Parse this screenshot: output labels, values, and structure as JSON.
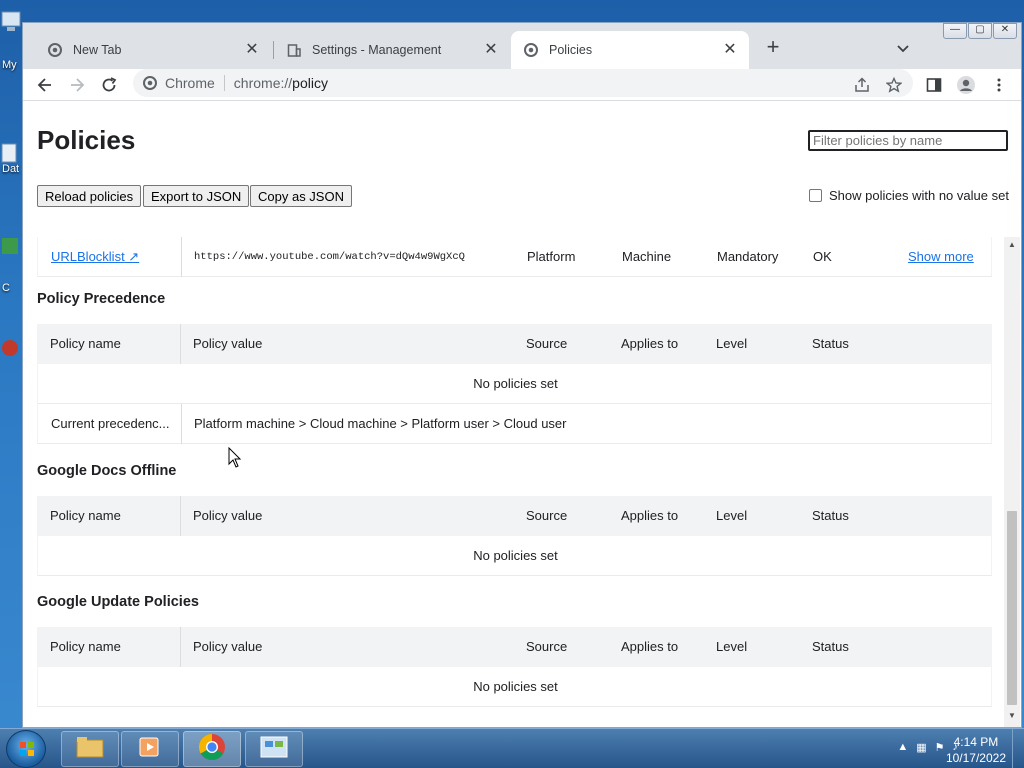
{
  "desktop": {
    "labels": [
      "My",
      "Dat",
      "C"
    ]
  },
  "browser": {
    "tabs": [
      {
        "title": "New Tab",
        "icon": "chrome-icon",
        "active": false
      },
      {
        "title": "Settings - Management",
        "icon": "building-icon",
        "active": false
      },
      {
        "title": "Policies",
        "icon": "chrome-icon",
        "active": true
      }
    ],
    "omnibox": {
      "chip": "Chrome",
      "url_scheme": "chrome://",
      "url_path": "policy"
    }
  },
  "page": {
    "title": "Policies",
    "filter_placeholder": "Filter policies by name",
    "buttons": {
      "reload": "Reload policies",
      "export": "Export to JSON",
      "copy": "Copy as JSON"
    },
    "show_no_value_label": "Show policies with no value set",
    "partial_row": {
      "name": "URLBlocklist",
      "value": "https://www.youtube.com/watch?v=dQw4w9WgXcQ",
      "source": "Platform",
      "applies_to": "Machine",
      "level": "Mandatory",
      "status": "OK",
      "action": "Show more"
    },
    "columns": {
      "name": "Policy name",
      "value": "Policy value",
      "source": "Source",
      "applies_to": "Applies to",
      "level": "Level",
      "status": "Status"
    },
    "sections": [
      {
        "title": "Policy Precedence",
        "empty_message": "No policies set",
        "extra_row": {
          "name": "Current precedenc...",
          "value": "Platform machine > Cloud machine > Platform user > Cloud user"
        }
      },
      {
        "title": "Google Docs Offline",
        "empty_message": "No policies set"
      },
      {
        "title": "Google Update Policies",
        "empty_message": "No policies set"
      }
    ]
  },
  "taskbar": {
    "time": "4:14 PM",
    "date": "10/17/2022"
  },
  "colors": {
    "link": "#1a73e8",
    "header_bg": "#f1f3f4",
    "tabstrip_bg": "#dee1e6"
  }
}
